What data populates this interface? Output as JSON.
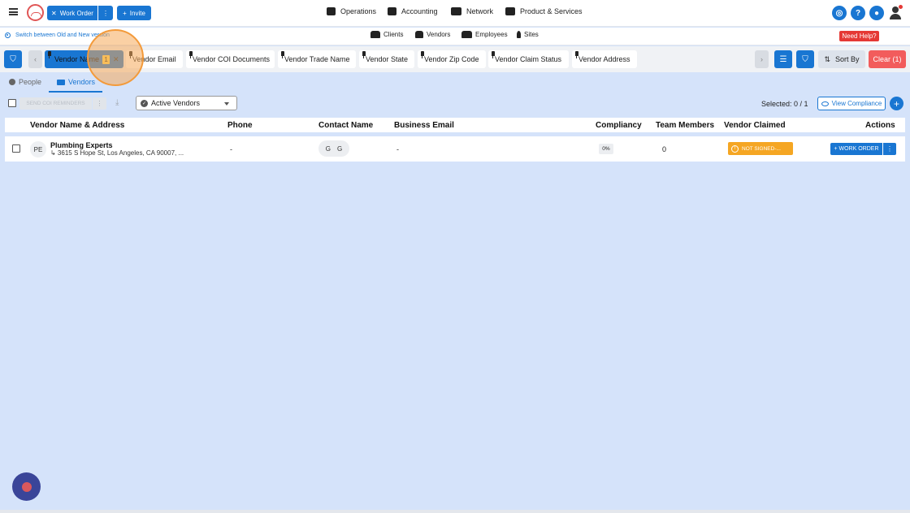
{
  "topbar": {
    "work_order_label": "Work Order",
    "invite_label": "Invite",
    "nav": [
      "Operations",
      "Accounting",
      "Network",
      "Product & Services"
    ],
    "help_icon_text": "?"
  },
  "subbar": {
    "switch_text": "Switch between Old and New version",
    "links": [
      "Clients",
      "Vendors",
      "Employees",
      "Sites"
    ],
    "need_help": "Need Help?"
  },
  "filters": {
    "chips": [
      {
        "label": "Vendor Name",
        "count": "1"
      },
      {
        "label": "Vendor Email"
      },
      {
        "label": "Vendor COI Documents"
      },
      {
        "label": "Vendor Trade Name"
      },
      {
        "label": "Vendor State"
      },
      {
        "label": "Vendor Zip Code"
      },
      {
        "label": "Vendor Claim Status"
      },
      {
        "label": "Vendor Address"
      }
    ],
    "sort_label": "Sort By",
    "clear_label": "Clear (1)"
  },
  "tabs": [
    "People",
    "Vendors"
  ],
  "actions": {
    "send_reminders": "SEND COI REMINDERS",
    "select_value": "Active Vendors",
    "selected_text": "Selected: 0 / 1",
    "view_compliance": "View Compliance"
  },
  "table": {
    "headers": [
      "Vendor Name & Address",
      "Phone",
      "Contact Name",
      "Business Email",
      "Compliancy",
      "Team Members",
      "Vendor Claimed",
      "Actions"
    ],
    "rows": [
      {
        "initials": "PE",
        "name": "Plumbing Experts",
        "address": "↳ 3615 S Hope St, Los Angeles, CA 90007, ...",
        "phone": "-",
        "contact_initials": [
          "G",
          "G"
        ],
        "email": "-",
        "compliancy": "0%",
        "team_members": "0",
        "claimed": "NOT SIGNED-...",
        "action_label": "+ WORK ORDER"
      }
    ]
  },
  "colors": {
    "accent": "#1976d2",
    "background": "#d5e3fa",
    "danger": "#f25c5c",
    "warning": "#f5a623"
  }
}
